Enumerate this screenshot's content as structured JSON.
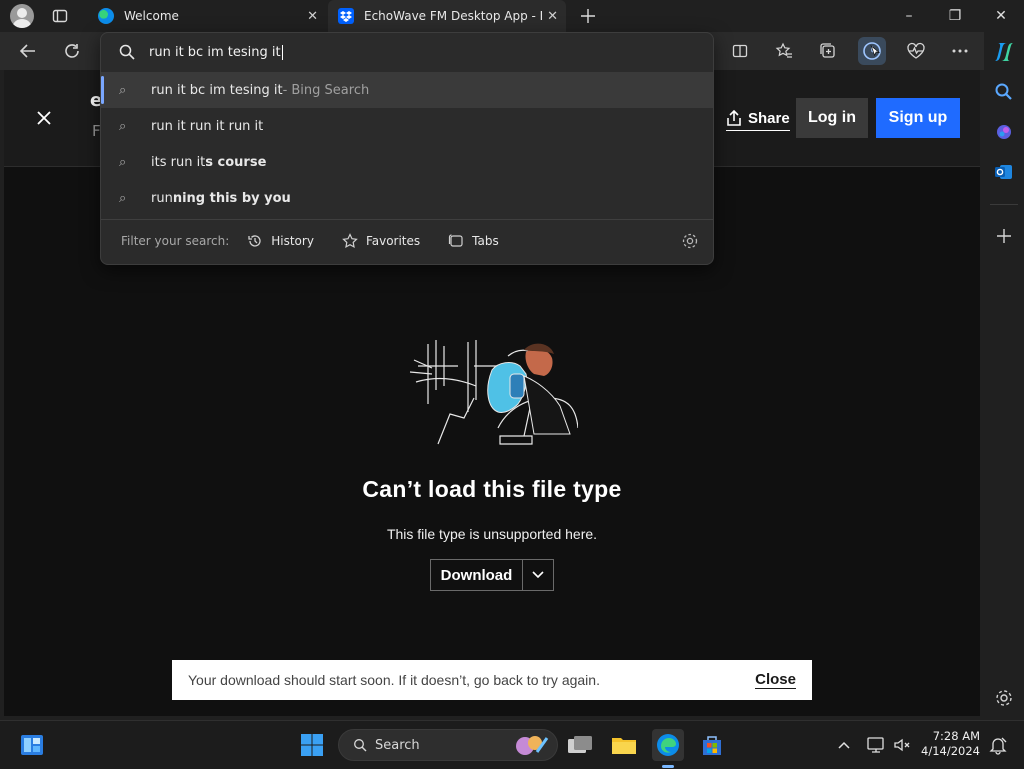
{
  "tabs": [
    {
      "title": "Welcome",
      "active": false
    },
    {
      "title": "EchoWave FM Desktop App - Dr",
      "active": true
    }
  ],
  "window_controls": {
    "minimize": "–",
    "restore": "❐",
    "close": "✕"
  },
  "omnibox": {
    "query": "run it bc im tesing it",
    "suggestions": [
      {
        "text": "run it bc im tesing it",
        "suffix": " - Bing Search"
      },
      {
        "text": "run it run it run it"
      },
      {
        "prefix": "its run it",
        "bold": "s course"
      },
      {
        "prefix": "run",
        "bold": "ning this by you"
      }
    ],
    "filter_label": "Filter your search:",
    "filters": [
      "History",
      "Favorites",
      "Tabs"
    ]
  },
  "page": {
    "partial_title": "e",
    "partial_subtitle": "F",
    "share_label": "Share",
    "login_label": "Log in",
    "signup_label": "Sign up",
    "heading": "Can’t load this file type",
    "message": "This file type is unsupported here.",
    "download_label": "Download",
    "toast_text": "Your download should start soon. If it doesn’t, go back to try again.",
    "toast_close": "Close"
  },
  "taskbar": {
    "search_label": "Search",
    "time": "7:28 AM",
    "date": "4/14/2024"
  },
  "colors": {
    "accent_blue": "#1f6bff",
    "edge_blue": "#0c8ce9"
  }
}
